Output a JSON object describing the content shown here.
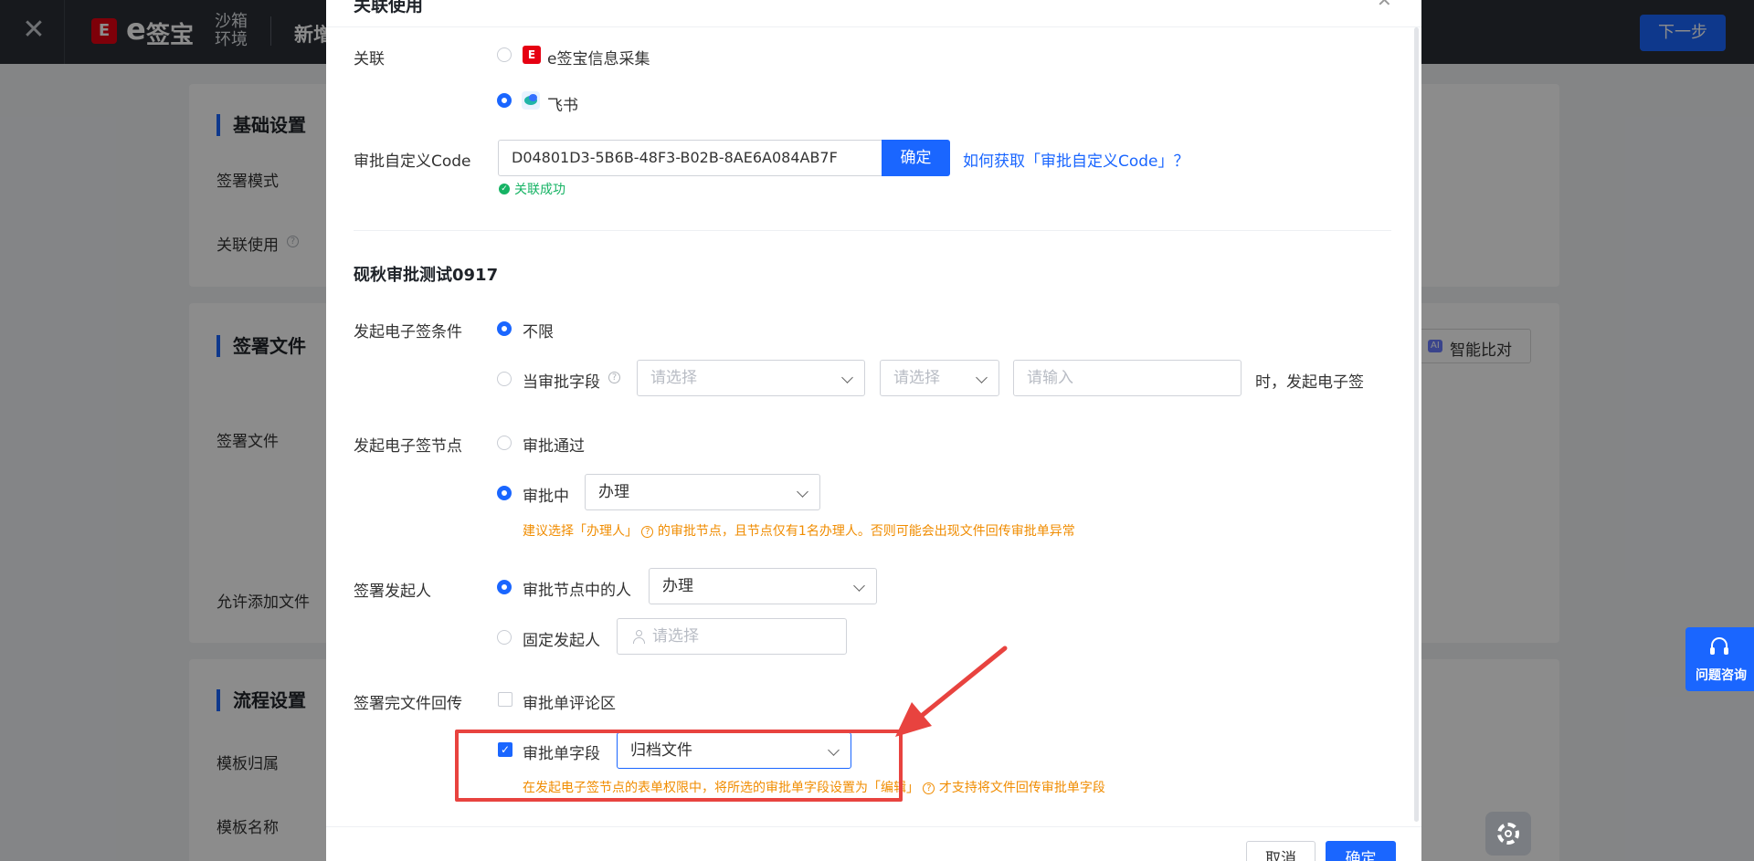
{
  "topbar": {
    "close_icon": "close-icon",
    "logo_text": "签宝",
    "env_line1": "沙箱",
    "env_line2": "环境",
    "page_title": "新增",
    "next_button": "下一步"
  },
  "background": {
    "sections": [
      {
        "title": "基础设置",
        "labels": [
          "签署模式",
          "关联使用"
        ]
      },
      {
        "title": "签署文件",
        "labels": [
          "签署文件",
          "允许添加文件"
        ],
        "ai_button": "智能比对",
        "ai_badge": "AI"
      },
      {
        "title": "流程设置",
        "labels": [
          "模板归属",
          "模板名称"
        ]
      }
    ]
  },
  "modal": {
    "title": "关联使用",
    "close_icon": "close-icon",
    "association": {
      "label": "关联",
      "options": [
        "e签宝信息采集",
        "飞书"
      ],
      "selected": "飞书"
    },
    "approval_code": {
      "label": "审批自定义Code",
      "value": "D04801D3-5B6B-48F3-B02B-8AE6A084AB7F",
      "confirm_button": "确定",
      "help_link": "如何获取「审批自定义Code」？",
      "success_text": "关联成功"
    },
    "form_name": "砚秋审批测试0917",
    "start_condition": {
      "label": "发起电子签条件",
      "option_unlimited": "不限",
      "option_field": "当审批字段",
      "select1_placeholder": "请选择",
      "select2_placeholder": "请选择",
      "input_placeholder": "请输入",
      "suffix": "时，发起电子签",
      "selected": "不限"
    },
    "start_node": {
      "label": "发起电子签节点",
      "option_approved": "审批通过",
      "option_in_progress": "审批中",
      "select_value": "办理",
      "selected": "审批中",
      "warning_prefix": "建议选择「办理人」",
      "warning_suffix": "的审批节点，且节点仅有1名办理人。否则可能会出现文件回传审批单异常"
    },
    "initiator": {
      "label": "签署发起人",
      "option_node_person": "审批节点中的人",
      "option_fixed": "固定发起人",
      "select_value": "办理",
      "fixed_placeholder": "请选择",
      "selected": "审批节点中的人"
    },
    "return": {
      "label": "签署完文件回传",
      "option_comment": "审批单评论区",
      "comment_checked": false,
      "option_field": "审批单字段",
      "field_checked": true,
      "field_select_value": "归档文件",
      "warning_prefix": "在发起电子签节点的表单权限中，将所选的审批单字段设置为「编辑」",
      "warning_suffix": "才支持将文件回传审批单字段"
    },
    "footer": {
      "cancel_button": "取消",
      "ok_button": "确定"
    }
  },
  "float_help": {
    "icon": "headset-icon",
    "label": "问题咨询"
  },
  "settings_fab_icon": "gear-icon",
  "colors": {
    "primary": "#1a66ff",
    "warning": "#f08c00",
    "success": "#16b364",
    "annotation": "#e8433f",
    "topbar": "#2b2f36"
  }
}
